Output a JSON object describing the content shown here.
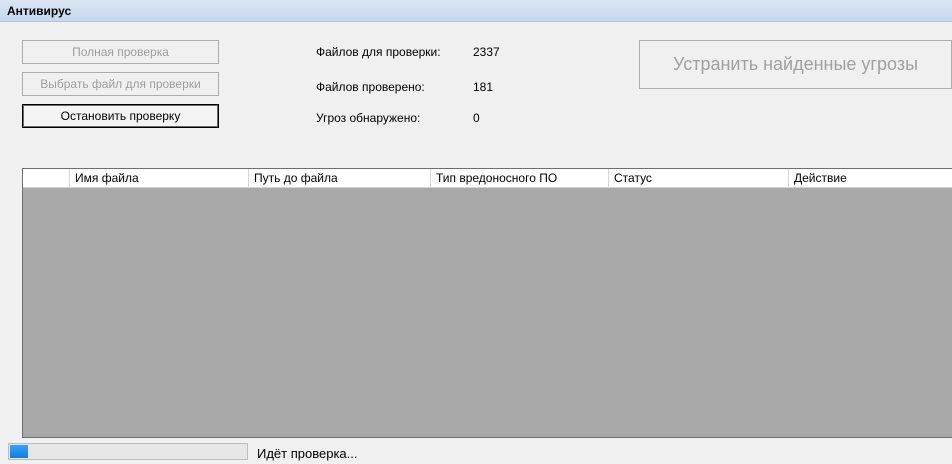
{
  "window": {
    "title": "Антивирус"
  },
  "buttons": {
    "full_scan": "Полная проверка",
    "choose_file": "Выбрать файл для проверки",
    "stop_scan": "Остановить проверку",
    "fix_threats": "Устранить найденные угрозы"
  },
  "stats": {
    "files_to_scan_label": "Файлов для проверки:",
    "files_to_scan_value": "2337",
    "files_scanned_label": "Файлов проверено:",
    "files_scanned_value": "181",
    "threats_label": "Угроз обнаружено:",
    "threats_value": "0"
  },
  "table": {
    "columns": [
      "",
      "Имя файла",
      "Путь до файла",
      "Тип вредоносного ПО",
      "Статус",
      "Действие"
    ],
    "rows": []
  },
  "progress": {
    "fraction": 0.0775
  },
  "status_text": "Идёт проверка...",
  "colors": {
    "titlebar": "#c6d7ee",
    "grid_background": "#a9a9a9",
    "progress_fill": "#1e88e5"
  }
}
